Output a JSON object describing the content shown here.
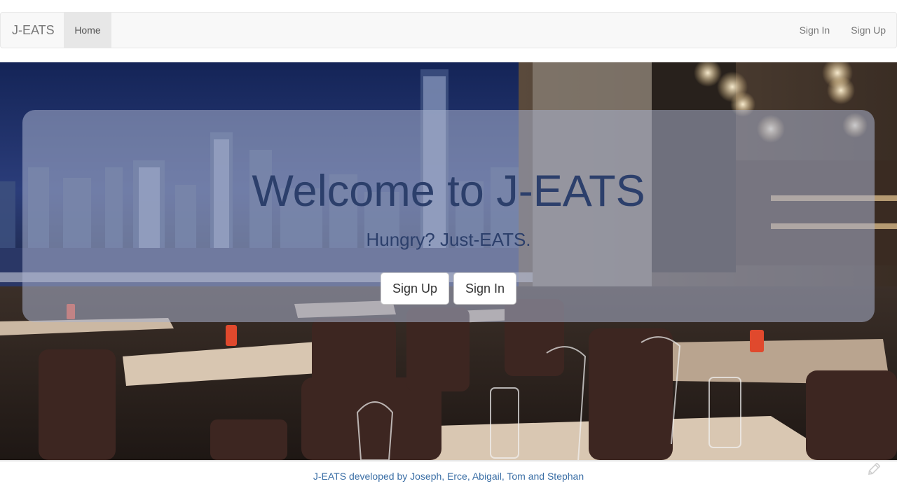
{
  "navbar": {
    "brand": "J-EATS",
    "home": "Home",
    "sign_in": "Sign In",
    "sign_up": "Sign Up"
  },
  "hero": {
    "title": "Welcome to J-EATS",
    "subtitle": "Hungry? Just-EATS.",
    "sign_up_button": "Sign Up",
    "sign_in_button": "Sign In"
  },
  "footer": {
    "credits": "J-EATS developed by Joseph, Erce, Abigail, Tom and Stephan"
  },
  "icons": {
    "corner": "edit-pencil-icon"
  },
  "colors": {
    "heading": "#2c3f6b",
    "footer_link": "#3a6ea5",
    "navbar_bg": "#f8f8f8"
  }
}
